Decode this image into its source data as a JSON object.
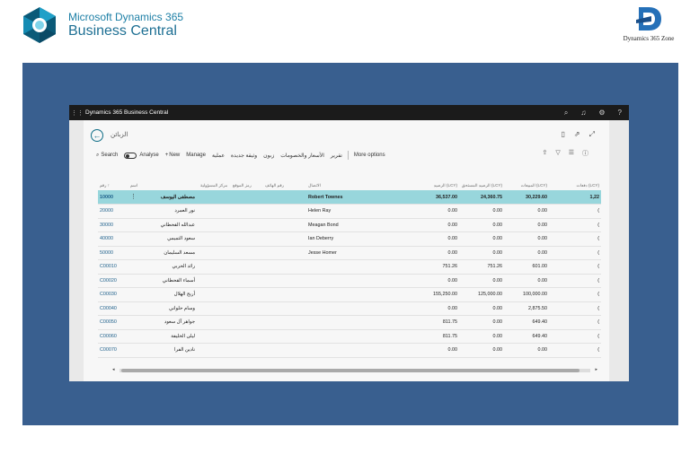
{
  "branding": {
    "ms_line1": "Microsoft Dynamics 365",
    "ms_line2": "Business Central",
    "zone_label": "Dynamics 365 Zone",
    "ms_colors": [
      "#0b5a78",
      "#1fa0c8",
      "#7fd4ea"
    ],
    "zone_color": "#2570b8"
  },
  "frame_color": "#395f8f",
  "window": {
    "title": "Dynamics 365 Business Central",
    "icons": [
      "search-icon",
      "bell-icon",
      "gear-icon",
      "help-icon"
    ]
  },
  "page": {
    "title": "الزبائن",
    "back_icon": "back-arrow-icon",
    "nav_icons": [
      "bookmark-icon",
      "open-new-window-icon",
      "expand-icon"
    ]
  },
  "actions": {
    "search": "Search",
    "analyse": "Analyse",
    "new": "New",
    "manage": "Manage",
    "arabic_items": [
      "عملية",
      "وثيقة جديدة",
      "زبون",
      "الأسعار والخصومات",
      "تقرير"
    ],
    "more": "More options",
    "right_icons": [
      "share-icon",
      "filter-icon",
      "list-view-icon",
      "info-icon"
    ]
  },
  "table": {
    "headers": [
      "رقم ↑",
      "اسم",
      "مركز المسؤولية",
      "رمز الموقع",
      "رقم الهاتف",
      "الاتصال",
      "الرصيد (LCY)",
      "الرصيد المستحق (LCY)",
      "المبيعات (LCY)",
      "دفعات (LCY)"
    ],
    "rows": [
      {
        "no": "10000",
        "name": "مصطفى اليوسف",
        "contact": "Robert Townes",
        "balance": "36,537.00",
        "due": "24,360.75",
        "sales": "30,229.60",
        "pay": "1,22",
        "selected": true
      },
      {
        "no": "20000",
        "name": "نور العمرد",
        "contact": "Helen Ray",
        "balance": "0.00",
        "due": "0.00",
        "sales": "0.00",
        "pay": "(",
        "selected": false
      },
      {
        "no": "30000",
        "name": "عبدالله القحطاني",
        "contact": "Meagan Bond",
        "balance": "0.00",
        "due": "0.00",
        "sales": "0.00",
        "pay": "(",
        "selected": false
      },
      {
        "no": "40000",
        "name": "سعود التميمي",
        "contact": "Ian Deberry",
        "balance": "0.00",
        "due": "0.00",
        "sales": "0.00",
        "pay": "(",
        "selected": false
      },
      {
        "no": "50000",
        "name": "مسعد السليمان",
        "contact": "Jesse Homer",
        "balance": "0.00",
        "due": "0.00",
        "sales": "0.00",
        "pay": "(",
        "selected": false
      },
      {
        "no": "C00010",
        "name": "رائد الحربي",
        "contact": "",
        "balance": "751.26",
        "due": "751.26",
        "sales": "601.00",
        "pay": "(",
        "selected": false
      },
      {
        "no": "C00020",
        "name": "أسماء القحطاني",
        "contact": "",
        "balance": "0.00",
        "due": "0.00",
        "sales": "0.00",
        "pay": "(",
        "selected": false
      },
      {
        "no": "C00030",
        "name": "أريج الهلال",
        "contact": "",
        "balance": "155,250.00",
        "due": "125,000.00",
        "sales": "100,000.00",
        "pay": "(",
        "selected": false
      },
      {
        "no": "C00040",
        "name": "وسام حلواني",
        "contact": "",
        "balance": "0.00",
        "due": "0.00",
        "sales": "2,875.50",
        "pay": "(",
        "selected": false
      },
      {
        "no": "C00050",
        "name": "جواهر آل سعود",
        "contact": "",
        "balance": "811.75",
        "due": "0.00",
        "sales": "649.40",
        "pay": "(",
        "selected": false
      },
      {
        "no": "C00060",
        "name": "ليلى الخليفة",
        "contact": "",
        "balance": "811.75",
        "due": "0.00",
        "sales": "649.40",
        "pay": "(",
        "selected": false
      },
      {
        "no": "C00070",
        "name": "نادين الفرا",
        "contact": "",
        "balance": "0.00",
        "due": "0.00",
        "sales": "0.00",
        "pay": "(",
        "selected": false
      }
    ]
  }
}
